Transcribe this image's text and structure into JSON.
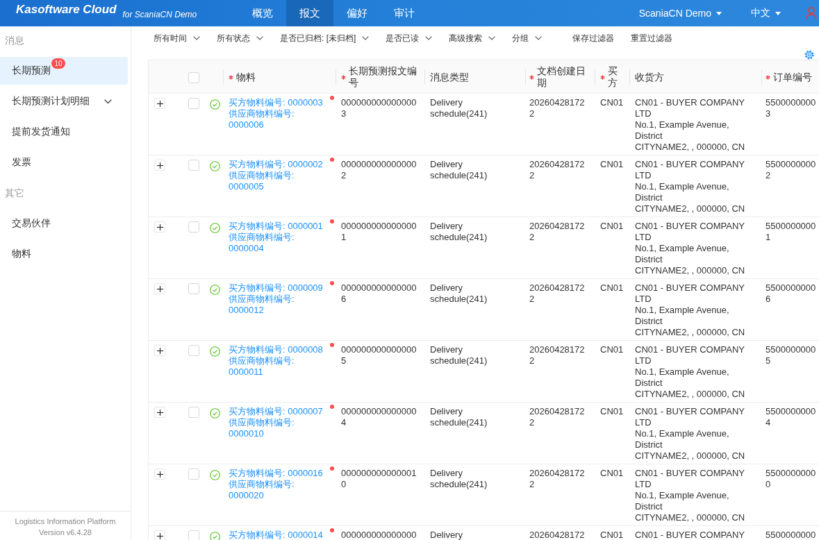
{
  "header": {
    "logo": "Kasoftware Cloud",
    "subtitle": "for ScaniaCN Demo",
    "nav": [
      {
        "label": "概览",
        "selected": false
      },
      {
        "label": "报文",
        "selected": true
      },
      {
        "label": "偏好",
        "selected": false
      },
      {
        "label": "审计",
        "selected": false
      }
    ],
    "account": "ScaniaCN Demo",
    "language": "中文"
  },
  "sidebar": {
    "sections": [
      {
        "title": "消息",
        "items": [
          {
            "label": "长期预测",
            "kind": "item",
            "selected": true,
            "badge": "10"
          },
          {
            "label": "长期预测计划明细",
            "kind": "submenu",
            "selected": false,
            "expanded": false
          },
          {
            "label": "提前发货通知",
            "kind": "item",
            "selected": false
          },
          {
            "label": "发票",
            "kind": "item",
            "selected": false
          }
        ]
      },
      {
        "title": "其它",
        "items": [
          {
            "label": "交易伙伴",
            "kind": "item",
            "selected": false
          },
          {
            "label": "物料",
            "kind": "item",
            "selected": false
          }
        ]
      }
    ],
    "footer": {
      "platform": "Logistics Information Platform",
      "version": "Version v6.4.28"
    }
  },
  "filters": [
    {
      "label": "所有时间",
      "kind": "dropdown"
    },
    {
      "label": "所有状态",
      "kind": "dropdown"
    },
    {
      "label": "是否已归档: [未归档]",
      "kind": "dropdown"
    },
    {
      "label": "是否已读",
      "kind": "dropdown"
    },
    {
      "label": "高级搜索",
      "kind": "dropdown"
    },
    {
      "label": "分组",
      "kind": "dropdown"
    },
    {
      "label": "保存过滤器",
      "kind": "action"
    },
    {
      "label": "重置过滤器",
      "kind": "action"
    }
  ],
  "table": {
    "header_checkbox": {
      "checked": false
    },
    "columns": [
      {
        "label": "物料",
        "required": true
      },
      {
        "label": "长期预测报文编号",
        "required": true
      },
      {
        "label": "消息类型",
        "required": false
      },
      {
        "label": "文档创建日期",
        "required": true
      },
      {
        "label": "买方",
        "required": true
      },
      {
        "label": "收货方",
        "required": false
      },
      {
        "label": "订单编号",
        "required": true
      }
    ],
    "rows": [
      {
        "expanded": false,
        "checked": false,
        "valid": true,
        "unread": true,
        "buyer_material": "买方物料编号: 0000003",
        "supplier_material": "供应商物料编号: 0000006",
        "message_no": "0000000000000003",
        "message_type": "Delivery schedule(241)",
        "created": "202604281722",
        "buyer": "CN01",
        "receiver": [
          "CN01 - BUYER COMPANY LTD",
          "No.1, Example Avenue, District",
          "CITYNAME2, , 000000, CN"
        ],
        "order_no": [
          "5500000000",
          "3"
        ]
      },
      {
        "expanded": false,
        "checked": false,
        "valid": true,
        "unread": true,
        "buyer_material": "买方物料编号: 0000002",
        "supplier_material": "供应商物料编号: 0000005",
        "message_no": "0000000000000002",
        "message_type": "Delivery schedule(241)",
        "created": "202604281722",
        "buyer": "CN01",
        "receiver": [
          "CN01 - BUYER COMPANY LTD",
          "No.1, Example Avenue, District",
          "CITYNAME2, , 000000, CN"
        ],
        "order_no": [
          "5500000000",
          "2"
        ]
      },
      {
        "expanded": false,
        "checked": false,
        "valid": true,
        "unread": true,
        "buyer_material": "买方物料编号: 0000001",
        "supplier_material": "供应商物料编号: 0000004",
        "message_no": "0000000000000001",
        "message_type": "Delivery schedule(241)",
        "created": "202604281722",
        "buyer": "CN01",
        "receiver": [
          "CN01 - BUYER COMPANY LTD",
          "No.1, Example Avenue, District",
          "CITYNAME2, , 000000, CN"
        ],
        "order_no": [
          "5500000000",
          "1"
        ]
      },
      {
        "expanded": false,
        "checked": false,
        "valid": true,
        "unread": true,
        "buyer_material": "买方物料编号: 0000009",
        "supplier_material": "供应商物料编号: 0000012",
        "message_no": "0000000000000006",
        "message_type": "Delivery schedule(241)",
        "created": "202604281722",
        "buyer": "CN01",
        "receiver": [
          "CN01 - BUYER COMPANY LTD",
          "No.1, Example Avenue, District",
          "CITYNAME2, , 000000, CN"
        ],
        "order_no": [
          "5500000000",
          "6"
        ]
      },
      {
        "expanded": false,
        "checked": false,
        "valid": true,
        "unread": true,
        "buyer_material": "买方物料编号: 0000008",
        "supplier_material": "供应商物料编号: 0000011",
        "message_no": "0000000000000005",
        "message_type": "Delivery schedule(241)",
        "created": "202604281722",
        "buyer": "CN01",
        "receiver": [
          "CN01 - BUYER COMPANY LTD",
          "No.1, Example Avenue, District",
          "CITYNAME2, , 000000, CN"
        ],
        "order_no": [
          "5500000000",
          "5"
        ]
      },
      {
        "expanded": false,
        "checked": false,
        "valid": true,
        "unread": true,
        "buyer_material": "买方物料编号: 0000007",
        "supplier_material": "供应商物料编号: 0000010",
        "message_no": "0000000000000004",
        "message_type": "Delivery schedule(241)",
        "created": "202604281722",
        "buyer": "CN01",
        "receiver": [
          "CN01 - BUYER COMPANY LTD",
          "No.1, Example Avenue, District",
          "CITYNAME2, , 000000, CN"
        ],
        "order_no": [
          "5500000000",
          "4"
        ]
      },
      {
        "expanded": false,
        "checked": false,
        "valid": true,
        "unread": true,
        "buyer_material": "买方物料编号: 0000016",
        "supplier_material": "供应商物料编号: 0000020",
        "message_no": "0000000000000010",
        "message_type": "Delivery schedule(241)",
        "created": "202604281722",
        "buyer": "CN01",
        "receiver": [
          "CN01 - BUYER COMPANY LTD",
          "No.1, Example Avenue, District",
          "CITYNAME2, , 000000, CN"
        ],
        "order_no": [
          "5500000000",
          "0"
        ]
      },
      {
        "expanded": false,
        "checked": false,
        "valid": true,
        "unread": true,
        "buyer_material": "买方物料编号: 0000014",
        "message_no": "000000000000000",
        "message_type": "Delivery",
        "created": "20260428172",
        "buyer": "CN01",
        "receiver": [
          "CN01 - BUYER COMPANY"
        ],
        "order_no": [
          "5500000000"
        ]
      }
    ]
  }
}
